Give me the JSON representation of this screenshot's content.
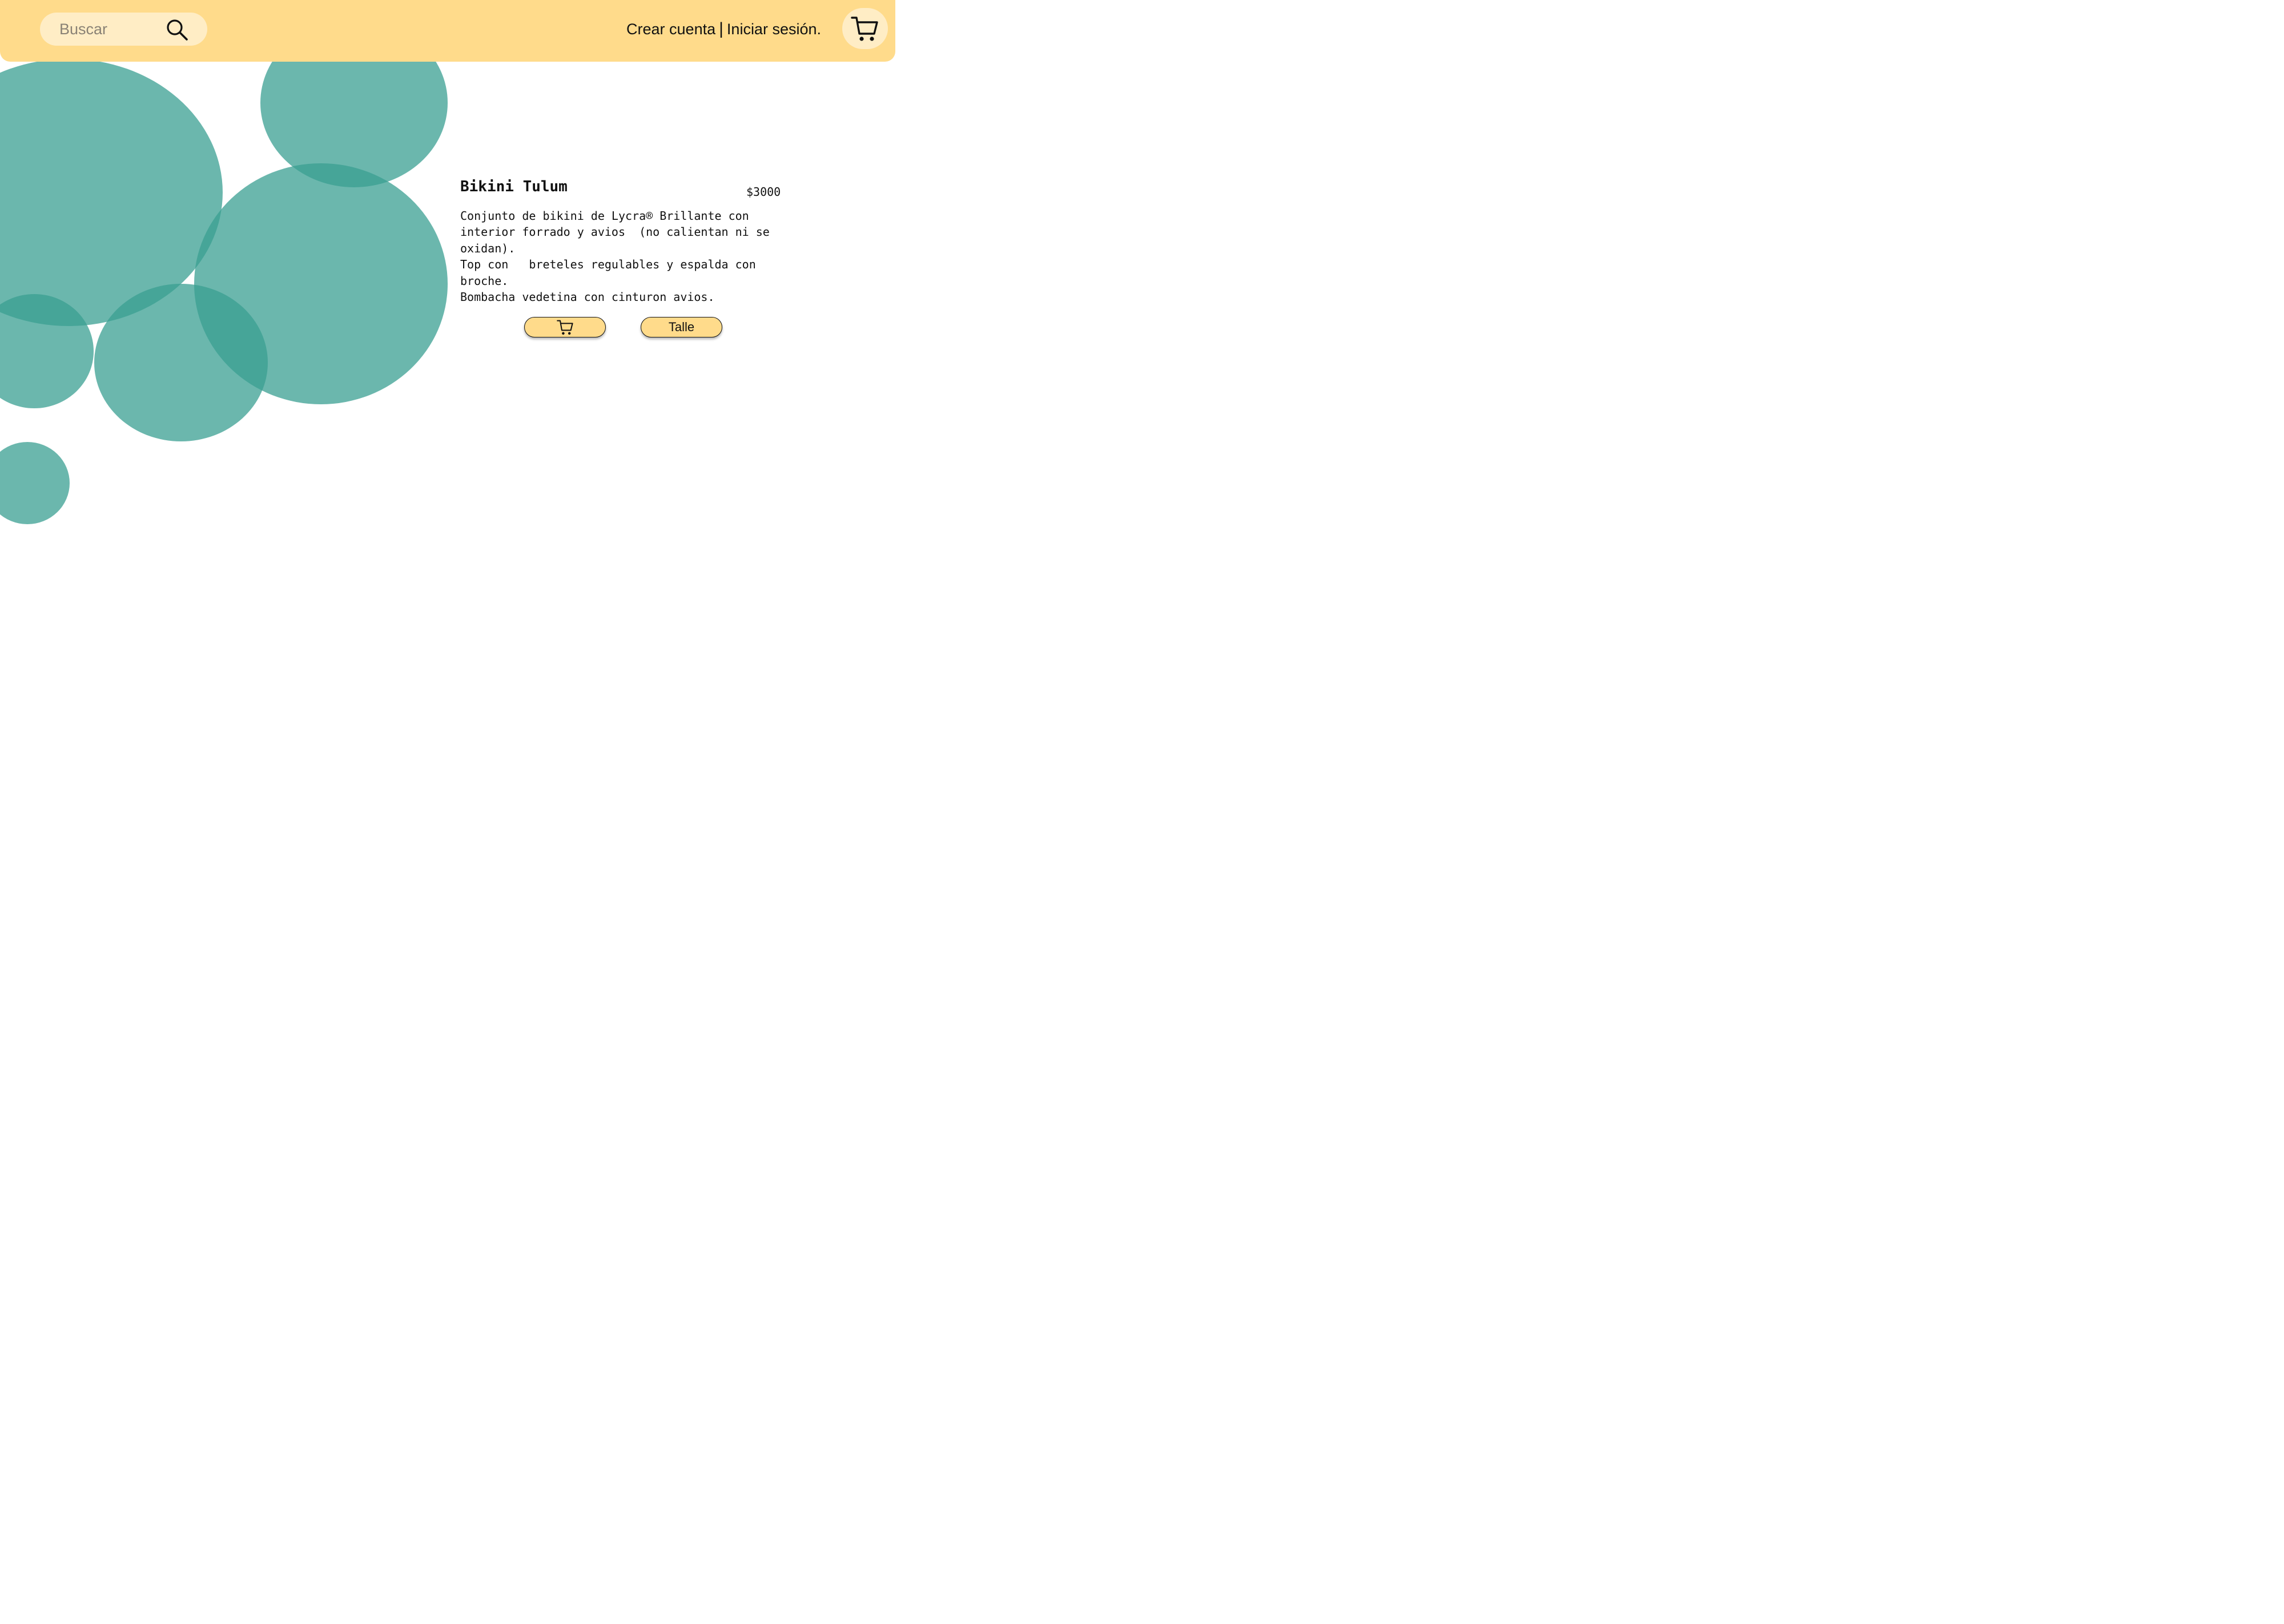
{
  "header": {
    "search": {
      "placeholder": "Buscar",
      "icon": "search-icon"
    },
    "auth": {
      "create_account": "Crear cuenta",
      "separator": "|",
      "login": "Iniciar sesión."
    },
    "cart_icon": "cart-icon"
  },
  "product": {
    "name": "Bikini Tulum",
    "price": "$3000",
    "description": "Conjunto de bikini de Lycra® Brillante con\ninterior forrado y avios  (no calientan ni se\noxidan).\nTop con   breteles regulables y espalda con\nbroche.\nBombacha vedetina con cinturon avios.",
    "add_to_cart_icon": "cart-icon",
    "size_button_label": "Talle"
  },
  "colors": {
    "header_bg": "#FFDB8B",
    "search_bg": "#FFEDC5",
    "circle_fill": "#3A9F92",
    "button_bg": "#FFDB8B"
  }
}
